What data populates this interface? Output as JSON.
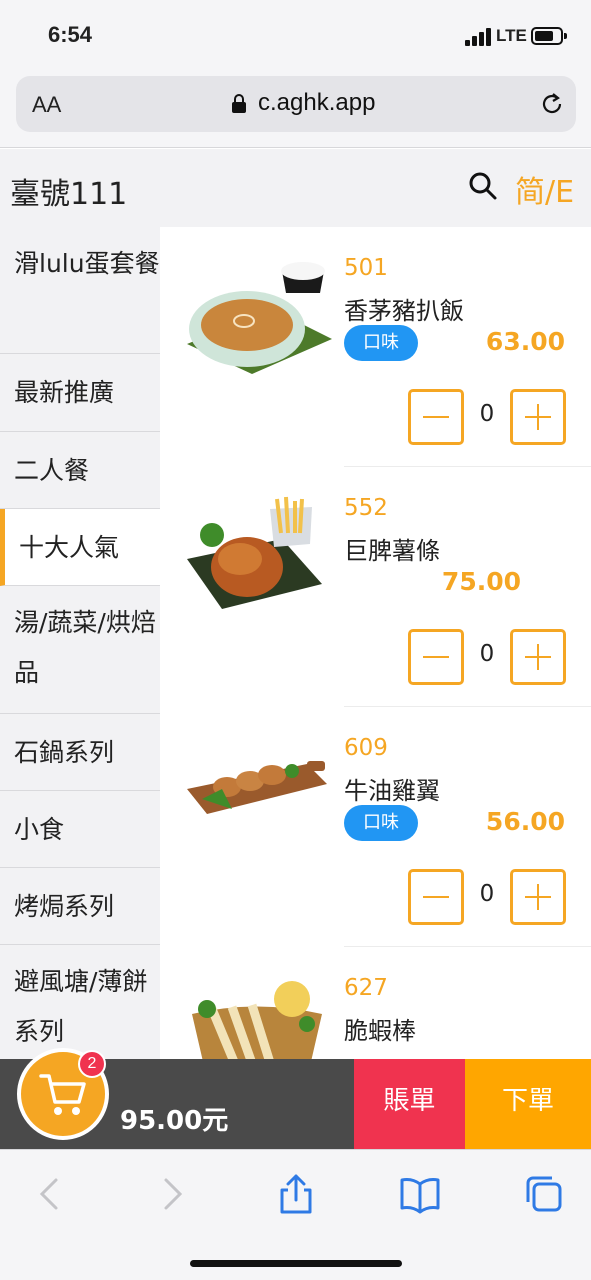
{
  "status": {
    "time": "6:54",
    "network": "LTE"
  },
  "browser": {
    "text_size_label": "AA",
    "url": "c.aghk.app"
  },
  "header": {
    "title": "臺號111",
    "lang_toggle": "简/E"
  },
  "categories": [
    "滑lulu蛋套餐",
    "最新推廣",
    "二人餐",
    "十大人氣",
    "湯/蔬菜/烘焙品",
    "石鍋系列",
    "小食",
    "烤焗系列",
    "避風塘/薄餅系列"
  ],
  "active_category": "十大人氣",
  "items": [
    {
      "code": "501",
      "name": "香茅豬扒飯",
      "flavor": "口味",
      "price": "63.00",
      "qty": "0"
    },
    {
      "code": "552",
      "name": "巨脾薯條",
      "flavor": "",
      "price": "75.00",
      "qty": "0"
    },
    {
      "code": "609",
      "name": "牛油雞翼",
      "flavor": "口味",
      "price": "56.00",
      "qty": "0"
    },
    {
      "code": "627",
      "name": "脆蝦棒",
      "flavor": "",
      "price": "",
      "qty": ""
    }
  ],
  "cart": {
    "count": "2",
    "total": "95.00元",
    "bill_label": "賬單",
    "order_label": "下單"
  },
  "colors": {
    "accent": "#f5a623",
    "flavor": "#2196f3",
    "bill": "#f0334f",
    "order": "#ffa600",
    "bar": "#4a4a4a"
  }
}
